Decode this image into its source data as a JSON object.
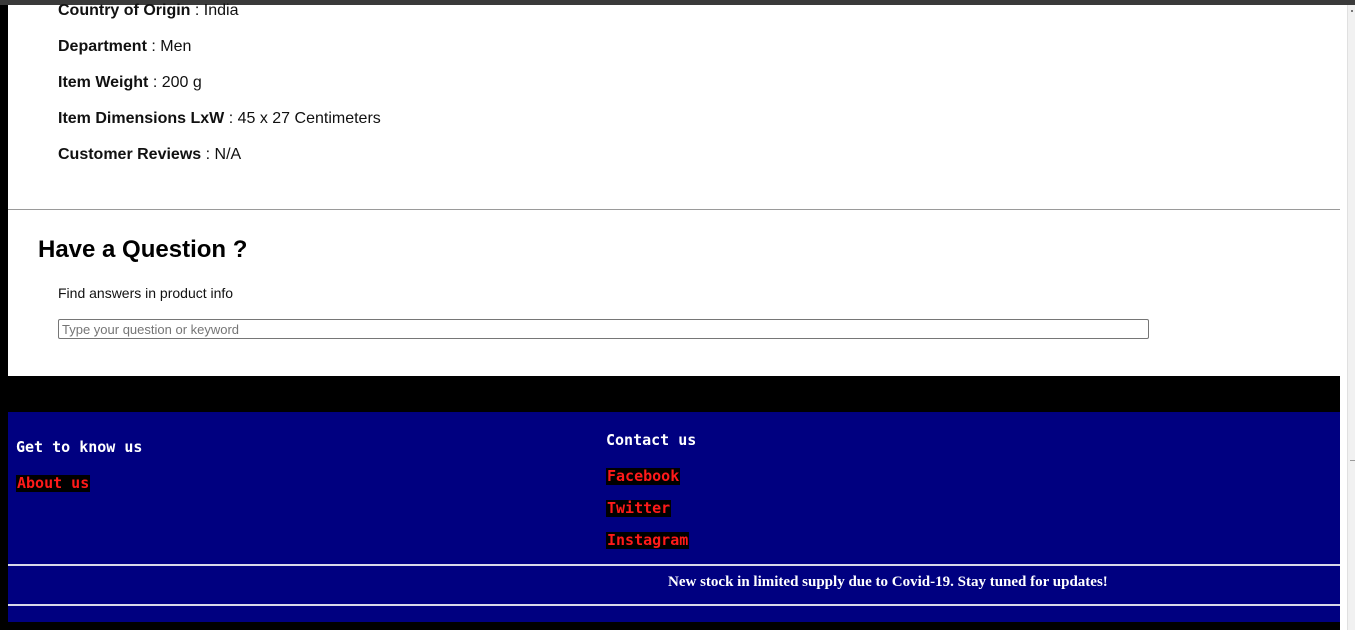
{
  "product_details": [
    {
      "label": "Country of Origin",
      "value": "India"
    },
    {
      "label": "Department",
      "value": "Men"
    },
    {
      "label": "Item Weight",
      "value": "200 g"
    },
    {
      "label": "Item Dimensions LxW",
      "value": "45 x 27 Centimeters"
    },
    {
      "label": "Customer Reviews",
      "value": "N/A"
    }
  ],
  "separator": " : ",
  "question": {
    "title": "Have a Question ?",
    "subtitle": "Find answers in product info",
    "placeholder": "Type your question or keyword",
    "value": ""
  },
  "footer": {
    "get_to_know": {
      "heading": "Get to know us",
      "links": [
        "About us"
      ]
    },
    "contact": {
      "heading": "Contact us",
      "links": [
        "Facebook",
        "Twitter",
        "Instagram"
      ]
    },
    "notice": "New stock in limited supply due to Covid-19. Stay tuned for updates!"
  },
  "colors": {
    "footer_bg": "#000080",
    "link_text": "#ff1a1a",
    "link_bg": "#000000",
    "page_bg": "#000000"
  }
}
